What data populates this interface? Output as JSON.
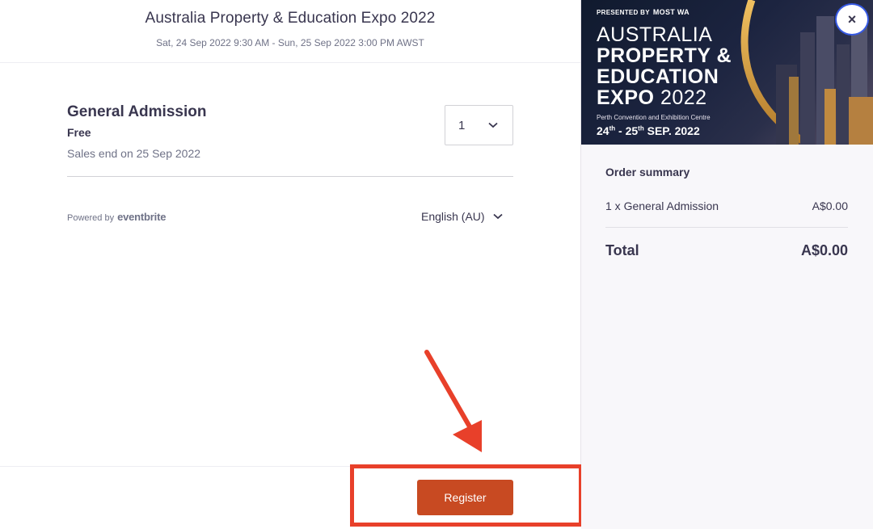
{
  "event": {
    "title": "Australia Property & Education Expo 2022",
    "date_range": "Sat, 24 Sep 2022 9:30 AM - Sun, 25 Sep 2022 3:00 PM AWST"
  },
  "ticket": {
    "name": "General Admission",
    "price": "Free",
    "sales_end": "Sales end on 25 Sep 2022",
    "quantity": "1"
  },
  "footer": {
    "powered_by": "Powered by",
    "brand": "eventbrite",
    "language": "English (AU)",
    "register_label": "Register"
  },
  "banner": {
    "presented_by": "PRESENTED BY",
    "sponsor": "MOST WA",
    "line1": "AUSTRALIA",
    "line2": "PROPERTY &",
    "line3": "EDUCATION",
    "line4_bold": "EXPO",
    "line4_year": "2022",
    "venue": "Perth Convention and Exhibition Centre",
    "day1": "24",
    "day1_suffix": "th",
    "dash": " - ",
    "day2": "25",
    "day2_suffix": "th",
    "month_year": " SEP. 2022"
  },
  "summary": {
    "title": "Order summary",
    "item_label": "1 x General Admission",
    "item_price": "A$0.00",
    "total_label": "Total",
    "total_value": "A$0.00"
  },
  "close_label": "×",
  "colors": {
    "accent": "#c84a22",
    "annotation": "#e8402a",
    "focus_ring": "#3659e3"
  }
}
